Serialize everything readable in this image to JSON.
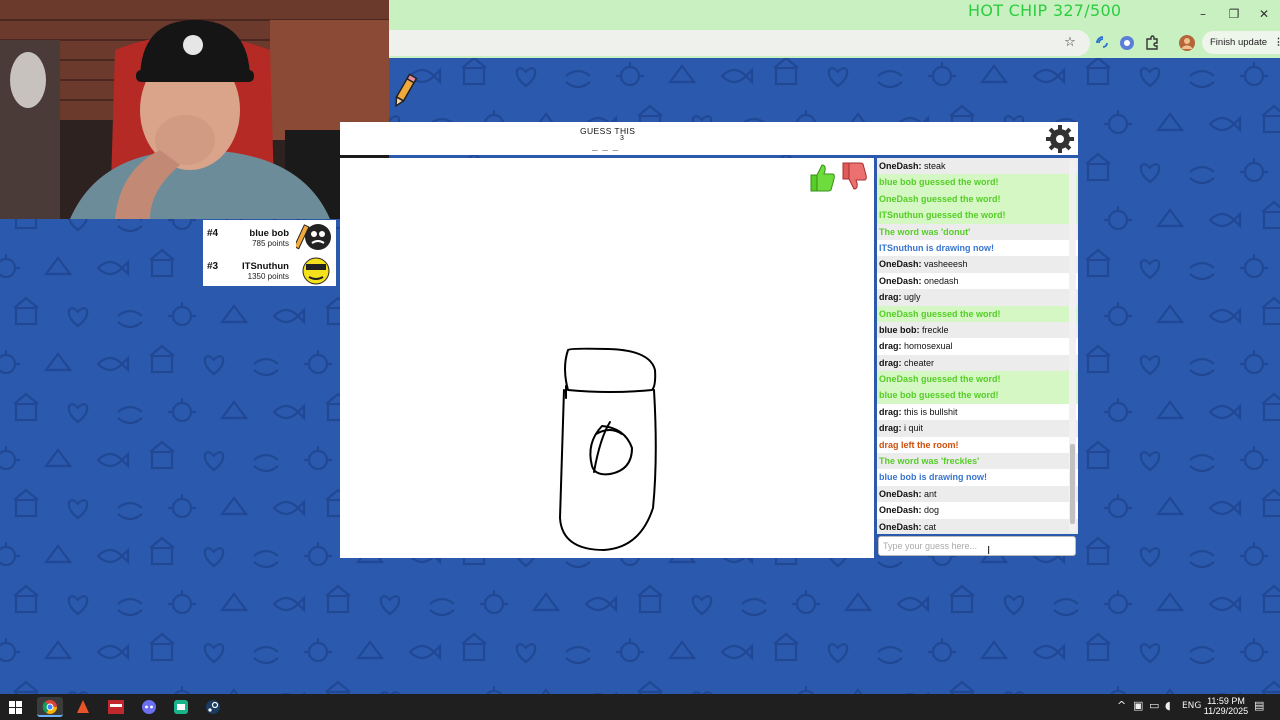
{
  "stream_overlay": {
    "title": "HOT CHIP 327/500"
  },
  "browser": {
    "finish_update_label": "Finish update",
    "window_buttons": [
      "–",
      "❐",
      "✕"
    ],
    "icons": [
      "star-icon",
      "cast-icon",
      "extension-icon",
      "puzzle-icon",
      "profile-avatar-icon",
      "menu-dots-icon"
    ]
  },
  "game": {
    "header": {
      "guess_label": "GUESS THIS",
      "letter_count": "3",
      "blanks": "_ _ _"
    },
    "scoreboard": [
      {
        "rank": "#4",
        "name": "blue bob",
        "score": "785 points"
      },
      {
        "rank": "#3",
        "name": "ITSnuthun",
        "score": "1350 points"
      }
    ],
    "chat": {
      "messages": [
        {
          "kind": "plain",
          "user": "OneDash:",
          "text": "steak"
        },
        {
          "kind": "correct",
          "text": "blue bob guessed the word!"
        },
        {
          "kind": "correct",
          "text": "OneDash guessed the word!"
        },
        {
          "kind": "correct",
          "text": "ITSnuthun guessed the word!"
        },
        {
          "kind": "reveal",
          "text": "The word was 'donut'"
        },
        {
          "kind": "drawing",
          "text": "ITSnuthun is drawing now!"
        },
        {
          "kind": "plain",
          "user": "OneDash:",
          "text": "vasheeesh"
        },
        {
          "kind": "plain",
          "user": "OneDash:",
          "text": "onedash"
        },
        {
          "kind": "plain",
          "user": "drag:",
          "text": "ugly"
        },
        {
          "kind": "correct",
          "text": "OneDash guessed the word!"
        },
        {
          "kind": "plain",
          "user": "blue bob:",
          "text": "freckle"
        },
        {
          "kind": "plain",
          "user": "drag:",
          "text": "homosexual"
        },
        {
          "kind": "plain",
          "user": "drag:",
          "text": "cheater"
        },
        {
          "kind": "correct",
          "text": "OneDash guessed the word!"
        },
        {
          "kind": "correct",
          "text": "blue bob guessed the word!"
        },
        {
          "kind": "plain",
          "user": "drag:",
          "text": "this is bullshit"
        },
        {
          "kind": "plain",
          "user": "drag:",
          "text": "i quit"
        },
        {
          "kind": "leave",
          "text": "drag left the room!"
        },
        {
          "kind": "reveal",
          "text": "The word was 'freckles'"
        },
        {
          "kind": "drawing",
          "text": "blue bob is drawing now!"
        },
        {
          "kind": "plain",
          "user": "OneDash:",
          "text": "ant"
        },
        {
          "kind": "plain",
          "user": "OneDash:",
          "text": "dog"
        },
        {
          "kind": "plain",
          "user": "OneDash:",
          "text": "cat"
        }
      ],
      "input_placeholder": "Type your guess here..."
    }
  },
  "taskbar": {
    "language": "ENG",
    "time": "11:59 PM",
    "date": "11/29/2025"
  },
  "colors": {
    "page_bg": "#2b59ad",
    "chrome_bg": "#c9f0c0",
    "correct_green": "#56ce27",
    "drawing_blue": "#3975ce",
    "leave_orange": "#ce4f0a"
  }
}
